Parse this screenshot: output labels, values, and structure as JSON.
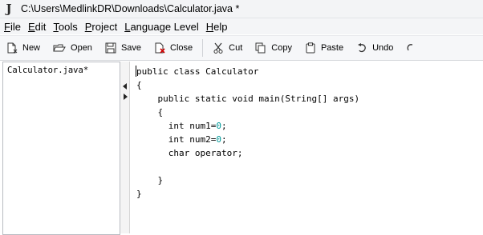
{
  "window": {
    "title": "C:\\Users\\MedlinkDR\\Downloads\\Calculator.java *"
  },
  "menu": [
    {
      "label": "File",
      "key": "F",
      "rest": "ile"
    },
    {
      "label": "Edit",
      "key": "E",
      "rest": "dit"
    },
    {
      "label": "Tools",
      "key": "T",
      "rest": "ools"
    },
    {
      "label": "Project",
      "key": "P",
      "rest": "roject"
    },
    {
      "label": "Language Level",
      "key": "L",
      "rest": "anguage Level"
    },
    {
      "label": "Help",
      "key": "H",
      "rest": "elp"
    }
  ],
  "toolbar": {
    "new": "New",
    "open": "Open",
    "save": "Save",
    "close": "Close",
    "cut": "Cut",
    "copy": "Copy",
    "paste": "Paste",
    "undo": "Undo"
  },
  "files": [
    "Calculator.java*"
  ],
  "code": {
    "lines": [
      [
        {
          "t": "public class Calculator",
          "c": "plain"
        }
      ],
      [
        {
          "t": "{",
          "c": "plain"
        }
      ],
      [
        {
          "t": "    public static void main(String[] args)",
          "c": "plain"
        }
      ],
      [
        {
          "t": "    {",
          "c": "plain"
        }
      ],
      [
        {
          "t": "      int num1=",
          "c": "plain"
        },
        {
          "t": "0",
          "c": "num"
        },
        {
          "t": ";",
          "c": "plain"
        }
      ],
      [
        {
          "t": "      int num2=",
          "c": "plain"
        },
        {
          "t": "0",
          "c": "num"
        },
        {
          "t": ";",
          "c": "plain"
        }
      ],
      [
        {
          "t": "      char operator;",
          "c": "plain"
        }
      ],
      [
        {
          "t": "",
          "c": "plain"
        }
      ],
      [
        {
          "t": "    }",
          "c": "plain"
        }
      ],
      [
        {
          "t": "}",
          "c": "plain"
        }
      ]
    ]
  },
  "colors": {
    "number": "#009999",
    "toolbar_bg": "#f6f7f9",
    "titlebar_bg": "#f3f4f6"
  }
}
